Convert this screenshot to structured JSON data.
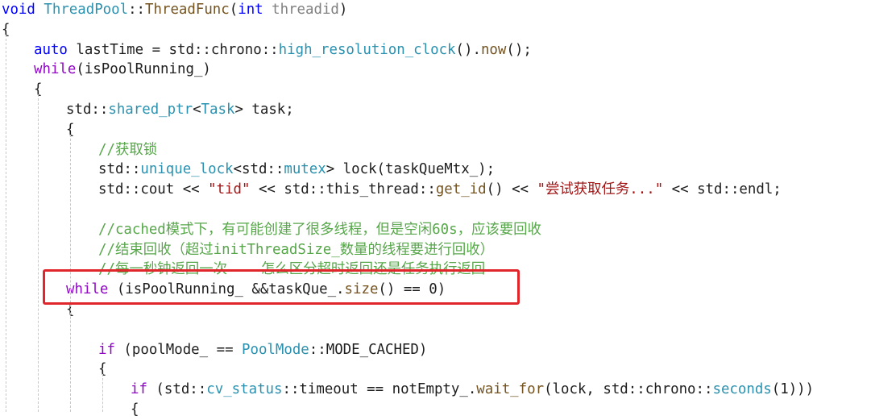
{
  "editor": {
    "lines": [
      {
        "indent": 0,
        "tokens": [
          {
            "t": "void",
            "c": "#0000ff"
          },
          {
            "t": " ",
            "c": "#1e1e1e"
          },
          {
            "t": "ThreadPool",
            "c": "#2b91af"
          },
          {
            "t": "::",
            "c": "#1e1e1e"
          },
          {
            "t": "ThreadFunc",
            "c": "#74531f"
          },
          {
            "t": "(",
            "c": "#1e1e1e"
          },
          {
            "t": "int",
            "c": "#0000ff"
          },
          {
            "t": " ",
            "c": "#1e1e1e"
          },
          {
            "t": "threadid",
            "c": "#808080"
          },
          {
            "t": ")",
            "c": "#1e1e1e"
          }
        ]
      },
      {
        "indent": 0,
        "tokens": [
          {
            "t": "{",
            "c": "#1e1e1e"
          }
        ]
      },
      {
        "indent": 1,
        "tokens": [
          {
            "t": "auto",
            "c": "#0000ff"
          },
          {
            "t": " lastTime = std::chrono::",
            "c": "#1e1e1e"
          },
          {
            "t": "high_resolution_clock",
            "c": "#2b91af"
          },
          {
            "t": "().",
            "c": "#1e1e1e"
          },
          {
            "t": "now",
            "c": "#74531f"
          },
          {
            "t": "();",
            "c": "#1e1e1e"
          }
        ]
      },
      {
        "indent": 1,
        "tokens": [
          {
            "t": "while",
            "c": "#8f08c4"
          },
          {
            "t": "(isPoolRunning_)",
            "c": "#1e1e1e"
          }
        ]
      },
      {
        "indent": 1,
        "tokens": [
          {
            "t": "{",
            "c": "#1e1e1e"
          }
        ]
      },
      {
        "indent": 2,
        "tokens": [
          {
            "t": "std::",
            "c": "#1e1e1e"
          },
          {
            "t": "shared_ptr",
            "c": "#2b91af"
          },
          {
            "t": "<",
            "c": "#1e1e1e"
          },
          {
            "t": "Task",
            "c": "#2b91af"
          },
          {
            "t": "> task;",
            "c": "#1e1e1e"
          }
        ]
      },
      {
        "indent": 2,
        "tokens": [
          {
            "t": "{",
            "c": "#1e1e1e"
          }
        ]
      },
      {
        "indent": 3,
        "tokens": [
          {
            "t": "//获取锁",
            "c": "#57a64a"
          }
        ]
      },
      {
        "indent": 3,
        "tokens": [
          {
            "t": "std::",
            "c": "#1e1e1e"
          },
          {
            "t": "unique_lock",
            "c": "#2b91af"
          },
          {
            "t": "<std::",
            "c": "#1e1e1e"
          },
          {
            "t": "mutex",
            "c": "#2b91af"
          },
          {
            "t": "> lock(taskQueMtx_);",
            "c": "#1e1e1e"
          }
        ]
      },
      {
        "indent": 3,
        "tokens": [
          {
            "t": "std::cout << ",
            "c": "#1e1e1e"
          },
          {
            "t": "\"tid\"",
            "c": "#a31515"
          },
          {
            "t": " << std::this_thread::",
            "c": "#1e1e1e"
          },
          {
            "t": "get_id",
            "c": "#74531f"
          },
          {
            "t": "() << ",
            "c": "#1e1e1e"
          },
          {
            "t": "\"尝试获取任务...\"",
            "c": "#a31515"
          },
          {
            "t": " << std::endl;",
            "c": "#1e1e1e"
          }
        ]
      },
      {
        "indent": 3,
        "tokens": []
      },
      {
        "indent": 3,
        "tokens": [
          {
            "t": "//cached模式下，有可能创建了很多线程，但是空闲60s，应该要回收",
            "c": "#57a64a"
          }
        ]
      },
      {
        "indent": 3,
        "tokens": [
          {
            "t": "//结束回收（超过initThreadSize_数量的线程要进行回收）",
            "c": "#57a64a"
          }
        ]
      },
      {
        "indent": 3,
        "tokens": [
          {
            "t": "//每一秒钟返回一次    怎么区分超时返回还是任务执行返回",
            "c": "#57a64a"
          }
        ]
      },
      {
        "indent": 2,
        "tokens": [
          {
            "t": "while",
            "c": "#8f08c4"
          },
          {
            "t": " (isPoolRunning_ &&taskQue_.",
            "c": "#1e1e1e"
          },
          {
            "t": "size",
            "c": "#74531f"
          },
          {
            "t": "() == 0)",
            "c": "#1e1e1e"
          }
        ]
      },
      {
        "indent": 2,
        "tokens": [
          {
            "t": "{",
            "c": "#1e1e1e"
          }
        ]
      },
      {
        "indent": 3,
        "tokens": []
      },
      {
        "indent": 3,
        "tokens": [
          {
            "t": "if",
            "c": "#8f08c4"
          },
          {
            "t": " (poolMode_ == ",
            "c": "#1e1e1e"
          },
          {
            "t": "PoolMode",
            "c": "#2b91af"
          },
          {
            "t": "::MODE_CACHED)",
            "c": "#1e1e1e"
          }
        ]
      },
      {
        "indent": 3,
        "tokens": [
          {
            "t": "{",
            "c": "#1e1e1e"
          }
        ]
      },
      {
        "indent": 4,
        "tokens": [
          {
            "t": "if",
            "c": "#8f08c4"
          },
          {
            "t": " (std::",
            "c": "#1e1e1e"
          },
          {
            "t": "cv_status",
            "c": "#2b91af"
          },
          {
            "t": "::timeout == notEmpty_.",
            "c": "#1e1e1e"
          },
          {
            "t": "wait_for",
            "c": "#74531f"
          },
          {
            "t": "(lock, std::chrono::",
            "c": "#1e1e1e"
          },
          {
            "t": "seconds",
            "c": "#2b91af"
          },
          {
            "t": "(1)))",
            "c": "#1e1e1e"
          }
        ]
      },
      {
        "indent": 4,
        "tokens": [
          {
            "t": "{",
            "c": "#1e1e1e"
          }
        ]
      }
    ],
    "highlight": {
      "line": 14,
      "color": "#e0262b"
    }
  }
}
